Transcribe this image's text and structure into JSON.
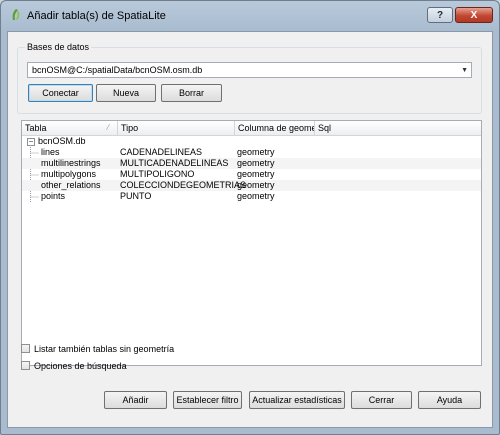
{
  "window": {
    "title": "Añadir tabla(s) de SpatiaLite",
    "help_label": "?",
    "close_label": "X"
  },
  "databases": {
    "group_label": "Bases de datos",
    "selected": "bcnOSM@C:/spatialData/bcnOSM.osm.db",
    "connect_label": "Conectar",
    "new_label": "Nueva",
    "delete_label": "Borrar"
  },
  "tree": {
    "columns": [
      "Tabla",
      "Tipo",
      "Columna de geome",
      "Sql"
    ],
    "root": "bcnOSM.db",
    "rows": [
      {
        "tabla": "lines",
        "tipo": "CADENADELINEAS",
        "columna": "geometry",
        "sql": ""
      },
      {
        "tabla": "multilinestrings",
        "tipo": "MULTICADENADELINEAS",
        "columna": "geometry",
        "sql": ""
      },
      {
        "tabla": "multipolygons",
        "tipo": "MULTIPOLIGONO",
        "columna": "geometry",
        "sql": ""
      },
      {
        "tabla": "other_relations",
        "tipo": "COLECCIONDEGEOMETRIAS",
        "columna": "geometry",
        "sql": ""
      },
      {
        "tabla": "points",
        "tipo": "PUNTO",
        "columna": "geometry",
        "sql": ""
      }
    ]
  },
  "options": {
    "list_no_geometry_label": "Listar también tablas sin geometría",
    "search_options_label": "Opciones de búsqueda"
  },
  "buttons": {
    "add_label": "Añadir",
    "filter_label": "Establecer filtro",
    "stats_label": "Actualizar estadísticas",
    "close_label": "Cerrar",
    "help_label": "Ayuda"
  }
}
